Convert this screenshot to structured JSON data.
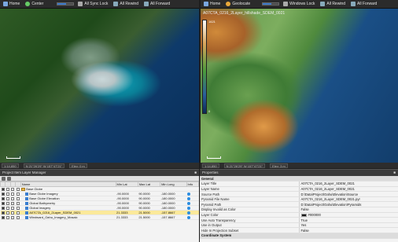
{
  "left_toolbar": {
    "home_label": "Home",
    "center_label": "Center",
    "zoom_level": 0.55,
    "sync_label": "All Sync Lock",
    "all_rewind_label": "All Rewind",
    "all_forward_label": "All Forward"
  },
  "right_toolbar": {
    "home_label": "Home",
    "geolocate_label": "Geolocate",
    "zoom_level": 0.55,
    "windows_label": "Windows Lock",
    "all_rewind_label": "All Rewind",
    "all_forward_label": "All Forward"
  },
  "right_view": {
    "title": "A07CTA_0216_2Layer_hillshade_SDEM_0021",
    "legend_top": "1621",
    "legend_bottom": "0"
  },
  "left_status": {
    "scale": "1:14,850",
    "coords": "N 21°26'29\" W 157°47'21\"",
    "elev": "Elev: 0 m"
  },
  "right_status": {
    "scale": "1:14,850",
    "coords": "N 21°26'29\" W 157°47'21\"",
    "elev": "Elev: 3 m"
  },
  "layer_manager": {
    "title": "Project Item Layer Manager",
    "columns": [
      "",
      "",
      "",
      "",
      "Name",
      "Min Lat",
      "Max Lat",
      "Min Long",
      "Info"
    ],
    "rows": [
      {
        "name": "Base Globe",
        "type": "folder",
        "min_lat": "",
        "max_lat": "",
        "min_long": "",
        "selected": false
      },
      {
        "name": "Base Globe Imagery",
        "type": "layer",
        "min_lat": "-90.0000",
        "max_lat": "90.0000",
        "min_long": "-180.0000",
        "selected": false
      },
      {
        "name": "Base Globe Elevation",
        "type": "layer",
        "min_lat": "-90.0000",
        "max_lat": "90.0000",
        "min_long": "-180.0000",
        "selected": false
      },
      {
        "name": "Global Bathymetry",
        "type": "layer",
        "min_lat": "-90.0000",
        "max_lat": "90.0000",
        "min_long": "-180.0000",
        "selected": false
      },
      {
        "name": "Global Imagery",
        "type": "layer",
        "min_lat": "-90.0000",
        "max_lat": "90.0000",
        "min_long": "-180.0000",
        "selected": false
      },
      {
        "name": "A07CTA_0216_2Layer_SDEM_0021",
        "type": "layer",
        "min_lat": "21.3333",
        "max_lat": "21.5000",
        "min_long": "-157.8667",
        "selected": true
      },
      {
        "name": "Windward_Oahu_Imagery_Mosaic",
        "type": "layer",
        "min_lat": "21.3333",
        "max_lat": "21.5000",
        "min_long": "-157.8667",
        "selected": false
      }
    ]
  },
  "properties": {
    "title": "Properties",
    "group_general": "General",
    "rows": [
      {
        "key": "Layer Title",
        "value": "A07CTA_0216_2Layer_SDEM_0021"
      },
      {
        "key": "Layer Name",
        "value": "A07CTA_0216_2Layer_SDEM_0021"
      },
      {
        "key": "Source Path",
        "value": "D:\\Data\\Project\\Oahu\\Elevation\\Source"
      },
      {
        "key": "Pyramid File Name",
        "value": "A07CTA_0216_2Layer_SDEM_0021.pyr"
      },
      {
        "key": "Pyramid Path",
        "value": "D:\\Data\\Project\\Oahu\\Elevation\\Pyramids"
      },
      {
        "key": "Display Invalid as Color",
        "value": "False"
      },
      {
        "key": "Layer Color",
        "value": "#000000"
      },
      {
        "key": "Use Auto Transparency",
        "value": "True"
      },
      {
        "key": "Use in Output",
        "value": "Yes"
      },
      {
        "key": "Hide In Projection Subset",
        "value": "False"
      }
    ],
    "group_coordinates": "Coordinate System",
    "accent_color": "#3a78c8"
  }
}
